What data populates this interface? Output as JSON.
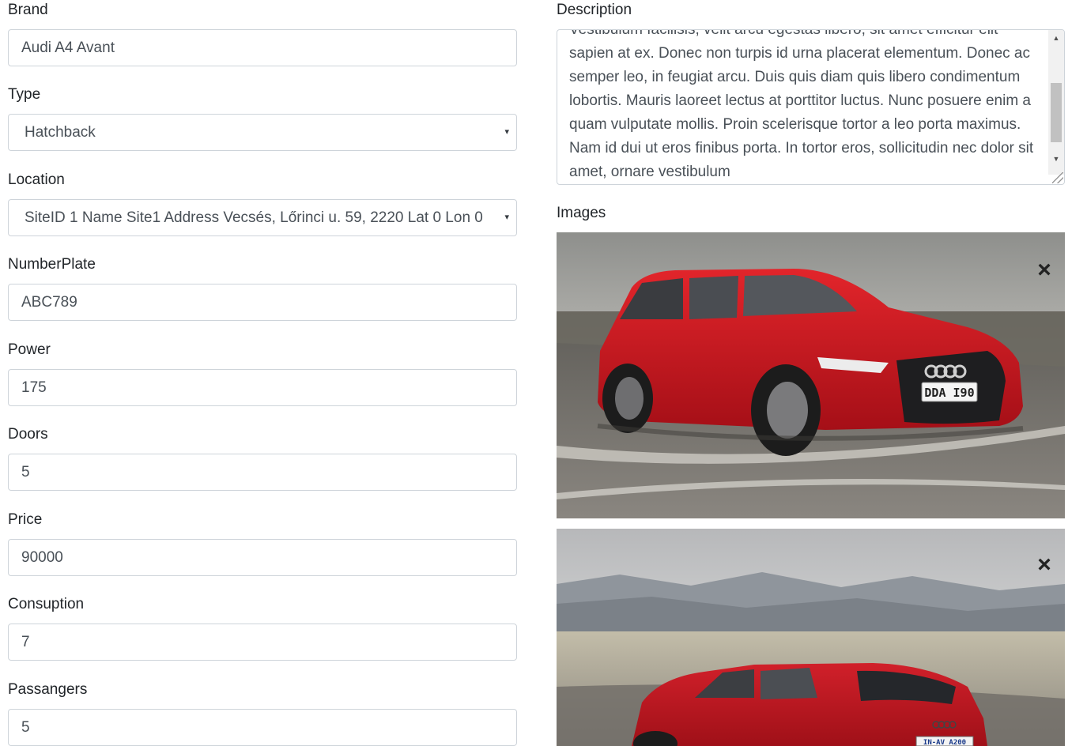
{
  "form": {
    "brand": {
      "label": "Brand",
      "value": "Audi A4 Avant"
    },
    "type": {
      "label": "Type",
      "value": "Hatchback"
    },
    "location": {
      "label": "Location",
      "value": "SiteID 1 Name Site1 Address Vecsés, Lőrinci u. 59, 2220 Lat 0 Lon 0"
    },
    "number_plate": {
      "label": "NumberPlate",
      "value": "ABC789"
    },
    "power": {
      "label": "Power",
      "value": "175"
    },
    "doors": {
      "label": "Doors",
      "value": "5"
    },
    "price": {
      "label": "Price",
      "value": "90000"
    },
    "consumption": {
      "label": "Consuption",
      "value": "7"
    },
    "passengers": {
      "label": "Passangers",
      "value": "5"
    }
  },
  "description": {
    "label": "Description",
    "text": "Vestibulum facilisis, velit arcu egestas libero, sit amet efficitur elit sapien at ex. Donec non turpis id urna placerat elementum. Donec ac semper leo, in feugiat arcu. Duis quis diam quis libero condimentum lobortis. Mauris laoreet lectus at porttitor luctus. Nunc posuere enim a quam vulputate mollis. Proin scelerisque tortor a leo porta maximus. Nam id dui ut eros finibus porta. In tortor eros, sollicitudin nec dolor sit amet, ornare vestibulum"
  },
  "images": {
    "label": "Images",
    "remove_symbol": "×",
    "plate_1": "DDA I90",
    "plate_2": "IN-AV A200"
  },
  "icons": {
    "select_caret": "▾",
    "scroll_up": "▲",
    "scroll_down": "▼"
  },
  "colors": {
    "car_red": "#c8131c",
    "border": "#ced4da",
    "input_text": "#495057"
  }
}
